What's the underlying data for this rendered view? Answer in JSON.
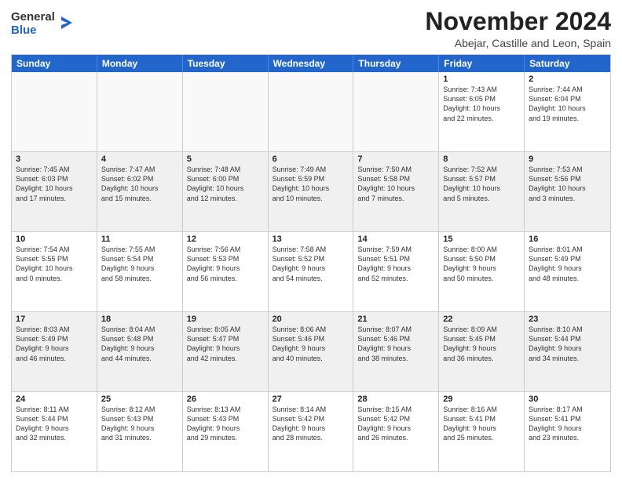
{
  "logo": {
    "general": "General",
    "blue": "Blue"
  },
  "title": "November 2024",
  "location": "Abejar, Castille and Leon, Spain",
  "days": [
    "Sunday",
    "Monday",
    "Tuesday",
    "Wednesday",
    "Thursday",
    "Friday",
    "Saturday"
  ],
  "rows": [
    [
      {
        "day": "",
        "content": ""
      },
      {
        "day": "",
        "content": ""
      },
      {
        "day": "",
        "content": ""
      },
      {
        "day": "",
        "content": ""
      },
      {
        "day": "",
        "content": ""
      },
      {
        "day": "1",
        "content": "Sunrise: 7:43 AM\nSunset: 6:05 PM\nDaylight: 10 hours\nand 22 minutes."
      },
      {
        "day": "2",
        "content": "Sunrise: 7:44 AM\nSunset: 6:04 PM\nDaylight: 10 hours\nand 19 minutes."
      }
    ],
    [
      {
        "day": "3",
        "content": "Sunrise: 7:45 AM\nSunset: 6:03 PM\nDaylight: 10 hours\nand 17 minutes."
      },
      {
        "day": "4",
        "content": "Sunrise: 7:47 AM\nSunset: 6:02 PM\nDaylight: 10 hours\nand 15 minutes."
      },
      {
        "day": "5",
        "content": "Sunrise: 7:48 AM\nSunset: 6:00 PM\nDaylight: 10 hours\nand 12 minutes."
      },
      {
        "day": "6",
        "content": "Sunrise: 7:49 AM\nSunset: 5:59 PM\nDaylight: 10 hours\nand 10 minutes."
      },
      {
        "day": "7",
        "content": "Sunrise: 7:50 AM\nSunset: 5:58 PM\nDaylight: 10 hours\nand 7 minutes."
      },
      {
        "day": "8",
        "content": "Sunrise: 7:52 AM\nSunset: 5:57 PM\nDaylight: 10 hours\nand 5 minutes."
      },
      {
        "day": "9",
        "content": "Sunrise: 7:53 AM\nSunset: 5:56 PM\nDaylight: 10 hours\nand 3 minutes."
      }
    ],
    [
      {
        "day": "10",
        "content": "Sunrise: 7:54 AM\nSunset: 5:55 PM\nDaylight: 10 hours\nand 0 minutes."
      },
      {
        "day": "11",
        "content": "Sunrise: 7:55 AM\nSunset: 5:54 PM\nDaylight: 9 hours\nand 58 minutes."
      },
      {
        "day": "12",
        "content": "Sunrise: 7:56 AM\nSunset: 5:53 PM\nDaylight: 9 hours\nand 56 minutes."
      },
      {
        "day": "13",
        "content": "Sunrise: 7:58 AM\nSunset: 5:52 PM\nDaylight: 9 hours\nand 54 minutes."
      },
      {
        "day": "14",
        "content": "Sunrise: 7:59 AM\nSunset: 5:51 PM\nDaylight: 9 hours\nand 52 minutes."
      },
      {
        "day": "15",
        "content": "Sunrise: 8:00 AM\nSunset: 5:50 PM\nDaylight: 9 hours\nand 50 minutes."
      },
      {
        "day": "16",
        "content": "Sunrise: 8:01 AM\nSunset: 5:49 PM\nDaylight: 9 hours\nand 48 minutes."
      }
    ],
    [
      {
        "day": "17",
        "content": "Sunrise: 8:03 AM\nSunset: 5:49 PM\nDaylight: 9 hours\nand 46 minutes."
      },
      {
        "day": "18",
        "content": "Sunrise: 8:04 AM\nSunset: 5:48 PM\nDaylight: 9 hours\nand 44 minutes."
      },
      {
        "day": "19",
        "content": "Sunrise: 8:05 AM\nSunset: 5:47 PM\nDaylight: 9 hours\nand 42 minutes."
      },
      {
        "day": "20",
        "content": "Sunrise: 8:06 AM\nSunset: 5:46 PM\nDaylight: 9 hours\nand 40 minutes."
      },
      {
        "day": "21",
        "content": "Sunrise: 8:07 AM\nSunset: 5:46 PM\nDaylight: 9 hours\nand 38 minutes."
      },
      {
        "day": "22",
        "content": "Sunrise: 8:09 AM\nSunset: 5:45 PM\nDaylight: 9 hours\nand 36 minutes."
      },
      {
        "day": "23",
        "content": "Sunrise: 8:10 AM\nSunset: 5:44 PM\nDaylight: 9 hours\nand 34 minutes."
      }
    ],
    [
      {
        "day": "24",
        "content": "Sunrise: 8:11 AM\nSunset: 5:44 PM\nDaylight: 9 hours\nand 32 minutes."
      },
      {
        "day": "25",
        "content": "Sunrise: 8:12 AM\nSunset: 5:43 PM\nDaylight: 9 hours\nand 31 minutes."
      },
      {
        "day": "26",
        "content": "Sunrise: 8:13 AM\nSunset: 5:43 PM\nDaylight: 9 hours\nand 29 minutes."
      },
      {
        "day": "27",
        "content": "Sunrise: 8:14 AM\nSunset: 5:42 PM\nDaylight: 9 hours\nand 28 minutes."
      },
      {
        "day": "28",
        "content": "Sunrise: 8:15 AM\nSunset: 5:42 PM\nDaylight: 9 hours\nand 26 minutes."
      },
      {
        "day": "29",
        "content": "Sunrise: 8:16 AM\nSunset: 5:41 PM\nDaylight: 9 hours\nand 25 minutes."
      },
      {
        "day": "30",
        "content": "Sunrise: 8:17 AM\nSunset: 5:41 PM\nDaylight: 9 hours\nand 23 minutes."
      }
    ]
  ]
}
